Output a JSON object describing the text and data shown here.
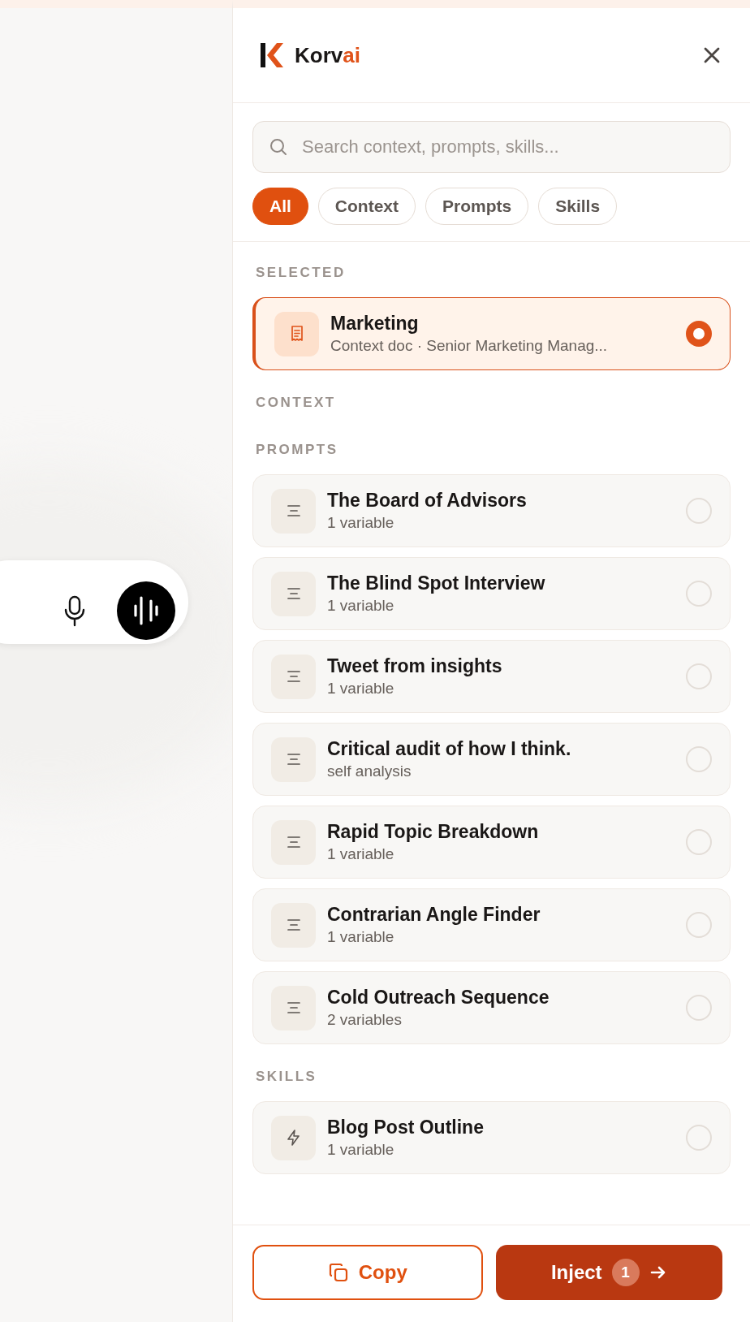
{
  "brand": {
    "name": "Korv",
    "accent": "ai"
  },
  "search": {
    "placeholder": "Search context, prompts, skills..."
  },
  "filters": [
    {
      "label": "All",
      "selected": true
    },
    {
      "label": "Context",
      "selected": false
    },
    {
      "label": "Prompts",
      "selected": false
    },
    {
      "label": "Skills",
      "selected": false
    }
  ],
  "sections": [
    {
      "title": "SELECTED",
      "items": [
        {
          "kind": "context",
          "title": "Marketing",
          "subtitle": "Context doc · Senior Marketing Manag...",
          "selected": true
        }
      ]
    },
    {
      "title": "CONTEXT"
    },
    {
      "title": "PROMPTS",
      "items": [
        {
          "kind": "prompt",
          "title": "The Board of Advisors",
          "subtitle": "1 variable",
          "selected": false
        },
        {
          "kind": "prompt",
          "title": "The Blind Spot Interview",
          "subtitle": "1 variable",
          "selected": false
        },
        {
          "kind": "prompt",
          "title": "Tweet from insights",
          "subtitle": "1 variable",
          "selected": false
        },
        {
          "kind": "prompt",
          "title": "Critical audit of how I think.",
          "subtitle": "self analysis",
          "selected": false
        },
        {
          "kind": "prompt",
          "title": "Rapid Topic Breakdown",
          "subtitle": "1 variable",
          "selected": false
        },
        {
          "kind": "prompt",
          "title": "Contrarian Angle Finder",
          "subtitle": "1 variable",
          "selected": false
        },
        {
          "kind": "prompt",
          "title": "Cold Outreach Sequence",
          "subtitle": "2 variables",
          "selected": false
        }
      ]
    },
    {
      "title": "SKILLS",
      "items": [
        {
          "kind": "skill",
          "title": "Blog Post Outline",
          "subtitle": "1 variable",
          "selected": false
        }
      ]
    }
  ],
  "footer": {
    "copy": "Copy",
    "inject": "Inject",
    "count": "1"
  }
}
